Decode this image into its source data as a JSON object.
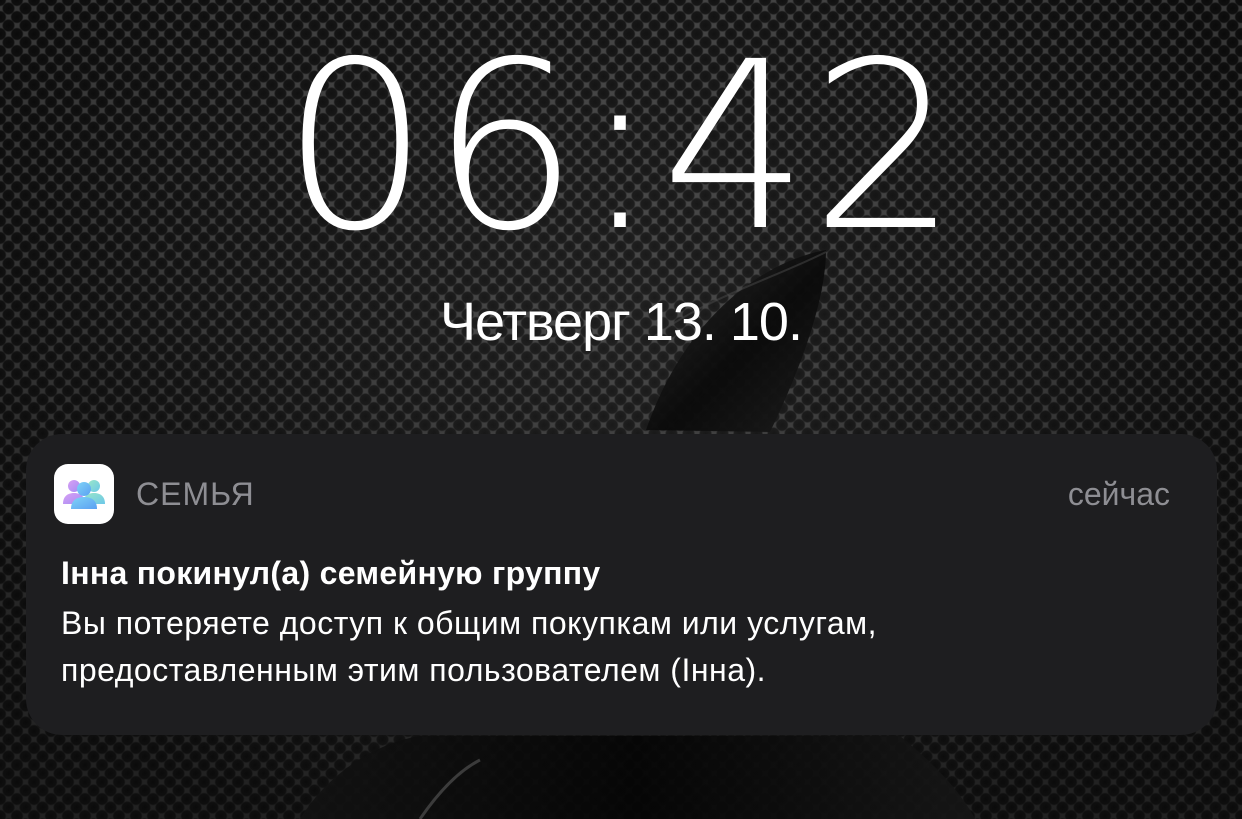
{
  "lockscreen": {
    "time": "06:42",
    "date": "Четверг 13. 10."
  },
  "notification": {
    "app_name": "СЕМЬЯ",
    "app_icon": "family-people-icon",
    "timestamp": "сейчас",
    "title": "Інна покинул(а) семейную группу",
    "body_line1": "Вы потеряете доступ к общим покупкам или услугам,",
    "body_line2": "предоставленным этим пользователем (Інна)."
  },
  "colors": {
    "notification_bg": "#1e1e20",
    "secondary_text": "#8e8e93",
    "primary_text": "#ffffff"
  }
}
